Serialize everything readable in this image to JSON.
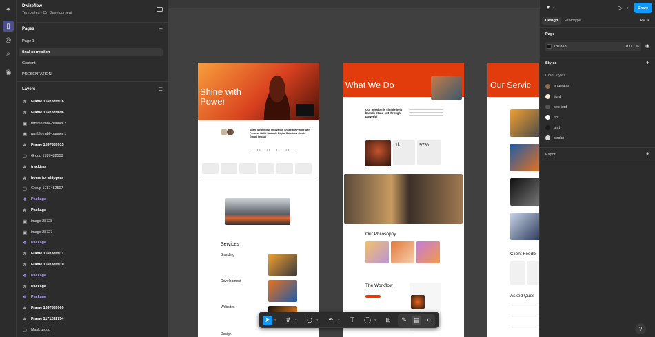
{
  "file": {
    "name": "Dwizeflow",
    "project": "Templates - On Development"
  },
  "pages": {
    "title": "Pages",
    "items": [
      {
        "label": "Page 1",
        "selected": false
      },
      {
        "label": "final correction",
        "selected": true
      },
      {
        "label": "Content",
        "selected": false
      },
      {
        "label": "PRESENTATION",
        "selected": false
      }
    ]
  },
  "layers": {
    "title": "Layers",
    "items": [
      {
        "label": "Frame 1597889916",
        "icon": "frame-icon",
        "style": "bold"
      },
      {
        "label": "Frame 1597889696",
        "icon": "frame-icon",
        "style": "bold"
      },
      {
        "label": "ramble-mbli-banner 2",
        "icon": "image-icon",
        "style": "normal"
      },
      {
        "label": "ramble-mbli-banner 1",
        "icon": "image-icon",
        "style": "normal"
      },
      {
        "label": "Frame 1597889915",
        "icon": "frame-icon",
        "style": "bold"
      },
      {
        "label": "Group 1787482508",
        "icon": "group-icon",
        "style": "normal"
      },
      {
        "label": "tracking",
        "icon": "frame-icon",
        "style": "bold"
      },
      {
        "label": "home for shippers",
        "icon": "frame-icon",
        "style": "bold"
      },
      {
        "label": "Group 1787482507",
        "icon": "group-icon",
        "style": "normal"
      },
      {
        "label": "Package",
        "icon": "component-icon",
        "style": "comp"
      },
      {
        "label": "Package",
        "icon": "frame-icon",
        "style": "bold"
      },
      {
        "label": "image 28728",
        "icon": "image-icon",
        "style": "normal"
      },
      {
        "label": "image 28727",
        "icon": "image-icon",
        "style": "normal"
      },
      {
        "label": "Package",
        "icon": "component-icon",
        "style": "comp"
      },
      {
        "label": "Frame 1597889911",
        "icon": "frame-icon",
        "style": "bold"
      },
      {
        "label": "Frame 1597889910",
        "icon": "frame-icon",
        "style": "bold"
      },
      {
        "label": "Package",
        "icon": "component-icon",
        "style": "comp"
      },
      {
        "label": "Package",
        "icon": "frame-icon",
        "style": "bold"
      },
      {
        "label": "Package",
        "icon": "component-icon",
        "style": "comp"
      },
      {
        "label": "Frame 1597889909",
        "icon": "frame-icon",
        "style": "bold"
      },
      {
        "label": "Frame 1171282754",
        "icon": "frame-icon",
        "style": "bold"
      },
      {
        "label": "Mask group",
        "icon": "group-icon",
        "style": "normal"
      }
    ]
  },
  "canvas": {
    "frame1": {
      "hero_title": "Shine with Power",
      "tagline": "Spark Meaningful Innovation Shape the Future with Purpose Build Scalable Digital Solutions Create Global Impact",
      "services_title": "Services",
      "services": [
        "Branding",
        "Development",
        "Websites",
        "Design"
      ]
    },
    "frame2": {
      "hero_title": "What We Do",
      "mission": "Our mission is simple help brands stand out through powerful",
      "stat1": "1k",
      "stat2": "97%",
      "philosophy_title": "Our Philosophy",
      "workflow_title": "The Workflow"
    },
    "frame3": {
      "hero_title": "Our Servic",
      "feedback_title": "Client Feedb",
      "faq_title": "Asked Ques"
    }
  },
  "toolbar": {
    "tools": [
      {
        "name": "move-tool",
        "glyph": "➤",
        "active": true
      },
      {
        "name": "frame-tool",
        "glyph": "#",
        "active": false
      },
      {
        "name": "shape-tool",
        "glyph": "○",
        "active": false
      },
      {
        "name": "pen-tool",
        "glyph": "✒",
        "active": false
      },
      {
        "name": "text-tool",
        "glyph": "T",
        "active": false
      },
      {
        "name": "comment-tool",
        "glyph": "◯",
        "active": false
      },
      {
        "name": "actions-tool",
        "glyph": "⊞",
        "active": false
      }
    ]
  },
  "right": {
    "tabs": [
      "Design",
      "Prototype"
    ],
    "zoom": "6%",
    "share_label": "Share",
    "page_section": "Page",
    "page_color": "181818",
    "page_opacity": "100",
    "page_opacity_unit": "%",
    "styles_section": "Styles",
    "color_styles_label": "Color styles",
    "color_styles": [
      {
        "label": "#090909",
        "color": "#8a6a4a"
      },
      {
        "label": "light",
        "color": "#f3ead8"
      },
      {
        "label": "sec text",
        "color": "#555555"
      },
      {
        "label": "tint",
        "color": "#ffffff"
      },
      {
        "label": "text",
        "color": "#1a1a1a"
      },
      {
        "label": "stroke",
        "color": "#d9d9d9"
      }
    ],
    "export_section": "Export"
  },
  "help_label": "?"
}
